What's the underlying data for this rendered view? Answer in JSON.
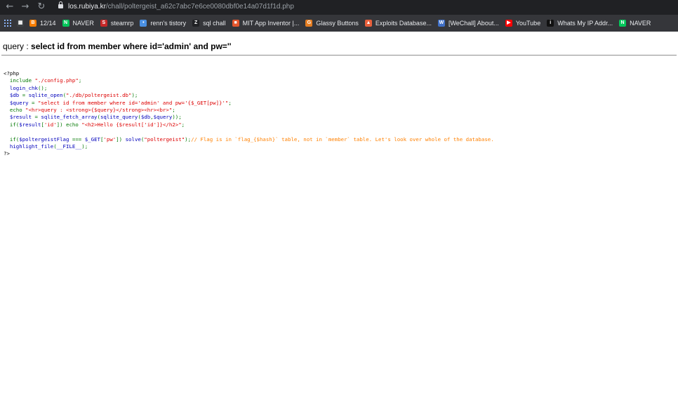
{
  "browser": {
    "url_host": "los.rubiya.kr",
    "url_path": "/chall/poltergeist_a62c7abc7e6ce0080dbf0e14a07d1f1d.php",
    "bookmarks": [
      {
        "label": "12/14",
        "icon": "blogger-icon",
        "color": "#f57c00",
        "glyph": "B"
      },
      {
        "label": "NAVER",
        "icon": "naver-icon",
        "color": "#03c75a",
        "glyph": "N"
      },
      {
        "label": "steamrp",
        "icon": "steam-icon",
        "color": "#c62828",
        "glyph": "S"
      },
      {
        "label": "renn's tistory",
        "icon": "tistory-icon",
        "color": "#4a90e2",
        "glyph": "•"
      },
      {
        "label": "sql chall",
        "icon": "z-icon",
        "color": "#202124",
        "glyph": "Z"
      },
      {
        "label": "MIT App Inventor |...",
        "icon": "mit-icon",
        "color": "#e4572e",
        "glyph": "■"
      },
      {
        "label": "Glassy Buttons",
        "icon": "glassy-icon",
        "color": "#e67e22",
        "glyph": "G"
      },
      {
        "label": "Exploits Database...",
        "icon": "exploitdb-icon",
        "color": "#e8603c",
        "glyph": "▲"
      },
      {
        "label": "[WeChall] About...",
        "icon": "wechall-icon",
        "color": "#3f6fc6",
        "glyph": "W"
      },
      {
        "label": "YouTube",
        "icon": "youtube-icon",
        "color": "#ff0000",
        "glyph": "▶"
      },
      {
        "label": "Whats My IP Addr...",
        "icon": "whatsmyip-icon",
        "color": "#111111",
        "glyph": "i"
      },
      {
        "label": "NAVER",
        "icon": "naver-icon",
        "color": "#03c75a",
        "glyph": "N"
      }
    ]
  },
  "page": {
    "query_prefix": "query : ",
    "query": "select id from member where id='admin' and pw=''"
  },
  "code": [
    [
      {
        "t": "htm",
        "v": "<?php"
      }
    ],
    [
      {
        "t": "def",
        "v": "  "
      },
      {
        "t": "kw",
        "v": "include "
      },
      {
        "t": "str",
        "v": "\"./config.php\""
      },
      {
        "t": "kw",
        "v": ";"
      }
    ],
    [
      {
        "t": "def",
        "v": "  login_chk"
      },
      {
        "t": "kw",
        "v": "();"
      }
    ],
    [
      {
        "t": "def",
        "v": "  $db "
      },
      {
        "t": "kw",
        "v": "= "
      },
      {
        "t": "def",
        "v": "sqlite_open"
      },
      {
        "t": "kw",
        "v": "("
      },
      {
        "t": "str",
        "v": "\"./db/poltergeist.db\""
      },
      {
        "t": "kw",
        "v": ");"
      }
    ],
    [
      {
        "t": "def",
        "v": "  $query "
      },
      {
        "t": "kw",
        "v": "= "
      },
      {
        "t": "str",
        "v": "\"select id from member where id='admin' and pw='{$_GET[pw]}'\""
      },
      {
        "t": "kw",
        "v": ";"
      }
    ],
    [
      {
        "t": "kw",
        "v": "  echo "
      },
      {
        "t": "str",
        "v": "\"<hr>query : <strong>{$query}</strong><hr><br>\""
      },
      {
        "t": "kw",
        "v": ";"
      }
    ],
    [
      {
        "t": "def",
        "v": "  $result "
      },
      {
        "t": "kw",
        "v": "= "
      },
      {
        "t": "def",
        "v": "sqlite_fetch_array"
      },
      {
        "t": "kw",
        "v": "("
      },
      {
        "t": "def",
        "v": "sqlite_query"
      },
      {
        "t": "kw",
        "v": "("
      },
      {
        "t": "def",
        "v": "$db"
      },
      {
        "t": "kw",
        "v": ","
      },
      {
        "t": "def",
        "v": "$query"
      },
      {
        "t": "kw",
        "v": "));"
      }
    ],
    [
      {
        "t": "kw",
        "v": "  if("
      },
      {
        "t": "def",
        "v": "$result"
      },
      {
        "t": "kw",
        "v": "["
      },
      {
        "t": "str",
        "v": "'id'"
      },
      {
        "t": "kw",
        "v": "]) echo "
      },
      {
        "t": "str",
        "v": "\"<h2>Hello {$result['id']}</h2>\""
      },
      {
        "t": "kw",
        "v": ";"
      }
    ],
    [
      {
        "t": "def",
        "v": ""
      }
    ],
    [
      {
        "t": "kw",
        "v": "  if("
      },
      {
        "t": "def",
        "v": "$poltergeistFlag "
      },
      {
        "t": "kw",
        "v": "=== "
      },
      {
        "t": "def",
        "v": "$_GET"
      },
      {
        "t": "kw",
        "v": "["
      },
      {
        "t": "str",
        "v": "'pw'"
      },
      {
        "t": "kw",
        "v": "]) "
      },
      {
        "t": "def",
        "v": "solve"
      },
      {
        "t": "kw",
        "v": "("
      },
      {
        "t": "str",
        "v": "\"poltergeist\""
      },
      {
        "t": "kw",
        "v": ");"
      },
      {
        "t": "com",
        "v": "// Flag is in `flag_{$hash}` table, not in `member` table. Let's look over whole of the database."
      }
    ],
    [
      {
        "t": "def",
        "v": "  highlight_file"
      },
      {
        "t": "kw",
        "v": "("
      },
      {
        "t": "def",
        "v": "__FILE__"
      },
      {
        "t": "kw",
        "v": ");"
      }
    ],
    [
      {
        "t": "htm",
        "v": "?>"
      }
    ]
  ]
}
